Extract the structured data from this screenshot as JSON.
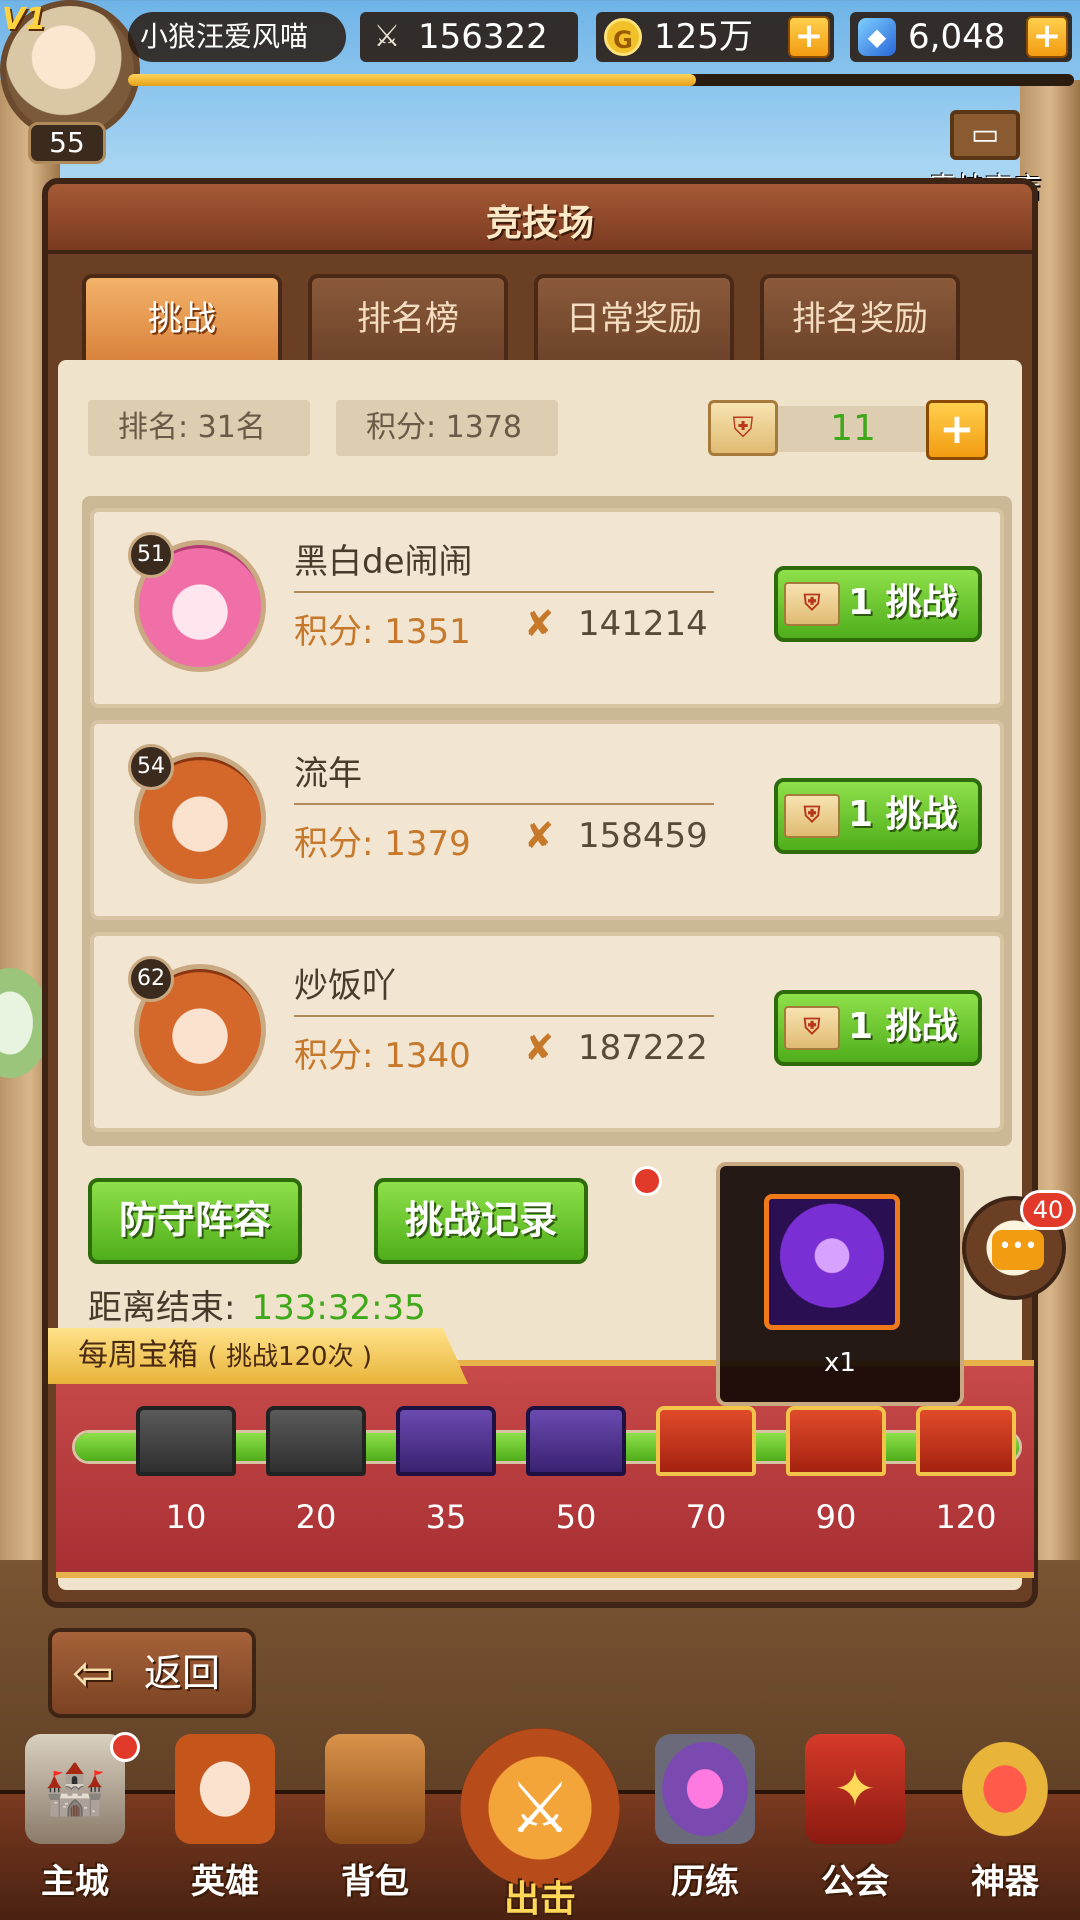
{
  "player": {
    "vip": "V1",
    "name": "小狼汪爱风喵",
    "level": "55",
    "power": "156322",
    "gold": "125万",
    "gems": "6,048",
    "xp_fraction": 0.6
  },
  "shop": {
    "label": "竞技商店"
  },
  "panel": {
    "title": "竞技场",
    "tabs": [
      "挑战",
      "排名榜",
      "日常奖励",
      "排名奖励"
    ],
    "active_tab": 0
  },
  "info": {
    "rank": "排名: 31名",
    "score": "积分: 1378",
    "tickets": "11"
  },
  "opponents": [
    {
      "level": "51",
      "name": "黑白de闹闹",
      "score": "积分: 1351",
      "power": "141214",
      "button": "1 挑战",
      "avatar_color": "pink"
    },
    {
      "level": "54",
      "name": "流年",
      "score": "积分: 1379",
      "power": "158459",
      "button": "1 挑战",
      "avatar_color": "red"
    },
    {
      "level": "62",
      "name": "炒饭吖",
      "score": "积分: 1340",
      "power": "187222",
      "button": "1 挑战",
      "avatar_color": "red"
    }
  ],
  "buttons": {
    "defense": "防守阵容",
    "record": "挑战记录"
  },
  "countdown": {
    "label": "距离结束:",
    "value": "133:32:35"
  },
  "weekly": {
    "title": "每周宝箱",
    "subtitle": "( 挑战120次 )",
    "progress_fraction": 1.0,
    "chests": [
      {
        "count": "10",
        "type": "gray"
      },
      {
        "count": "20",
        "type": "gray"
      },
      {
        "count": "35",
        "type": "purple"
      },
      {
        "count": "50",
        "type": "purple"
      },
      {
        "count": "70",
        "type": "gold"
      },
      {
        "count": "90",
        "type": "gold"
      },
      {
        "count": "120",
        "type": "gold"
      }
    ]
  },
  "tooltip": {
    "item": "purple-orb-icon",
    "count": "x1"
  },
  "chat": {
    "unread": "40"
  },
  "back": {
    "label": "返回"
  },
  "nav": [
    {
      "label": "主城",
      "icon": "castle-icon"
    },
    {
      "label": "英雄",
      "icon": "hero-icon"
    },
    {
      "label": "背包",
      "icon": "backpack-icon"
    },
    {
      "label": "出击",
      "icon": "crossed-swords-icon"
    },
    {
      "label": "历练",
      "icon": "portal-icon"
    },
    {
      "label": "公会",
      "icon": "guild-banner-icon"
    },
    {
      "label": "神器",
      "icon": "artifact-icon"
    }
  ],
  "colors": {
    "accent_green": "#4fae1a",
    "score_orange": "#c6782b",
    "alert_red": "#e23a2a"
  }
}
